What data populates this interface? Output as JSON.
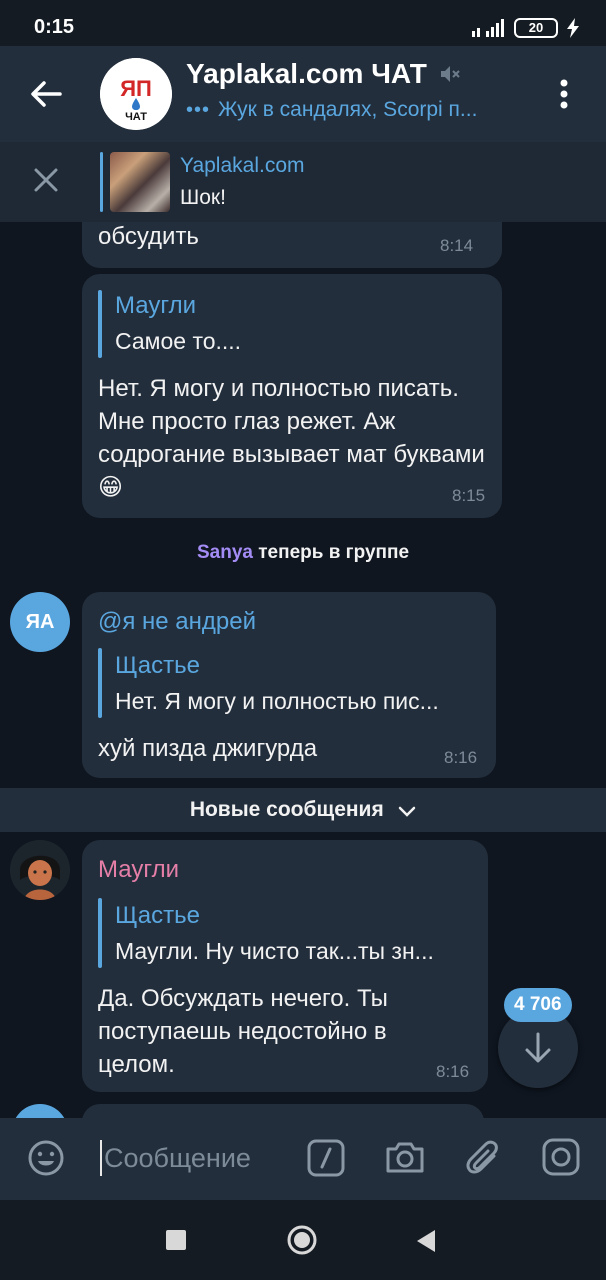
{
  "status_bar": {
    "time": "0:15",
    "battery": "20"
  },
  "header": {
    "title": "Yaplakal.com ЧАТ",
    "typing_text": "Жук в сандалях, Scorpi п...",
    "avatar_logo_top": "ЯП",
    "avatar_logo_bottom": "ЧАТ"
  },
  "pinned": {
    "title": "Yaplakal.com",
    "text": "Шок!"
  },
  "messages": [
    {
      "text": "обсудить",
      "time": "8:14"
    },
    {
      "reply_name": "Маугли",
      "reply_text": "Самое то....",
      "text": "Нет. Я могу и полностью писать. Мне просто глаз режет. Аж содрогание вызывает мат буквами😁",
      "time": "8:15"
    },
    {
      "avatar_initials": "ЯА",
      "mention": "@я не андрей",
      "reply_name": "Щастье",
      "reply_text": "Нет. Я могу и полностью пис...",
      "text": "хуй пизда джигурда",
      "time": "8:16"
    },
    {
      "sender": "Маугли",
      "reply_name": "Щастье",
      "reply_text": "Маугли. Ну чисто так...ты зн...",
      "text": "Да. Обсуждать нечего. Ты поступаешь недостойно в целом.",
      "time": "8:16"
    }
  ],
  "service": {
    "name": "Sanya",
    "text": " теперь в группе"
  },
  "new_messages": {
    "label": "Новые сообщения"
  },
  "scroll": {
    "badge": "4 706"
  },
  "input": {
    "placeholder": "Сообщение"
  },
  "colors": {
    "accent": "#5aa7e0",
    "bubble": "#232e3c",
    "mowgli_name": "#e67fa8",
    "service_name": "#a48cf5"
  },
  "icons": [
    "back-arrow-icon",
    "mute-icon",
    "more-vert-icon",
    "close-icon",
    "chevron-down-icon",
    "arrow-down-icon",
    "emoji-icon",
    "bot-command-icon",
    "camera-icon",
    "attach-icon",
    "instagram-icon"
  ]
}
